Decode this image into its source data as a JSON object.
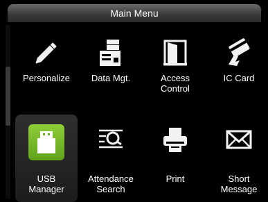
{
  "header": {
    "title": "Main Menu"
  },
  "menu": {
    "items": [
      {
        "label": "Personalize",
        "icon": "pencil-icon"
      },
      {
        "label": "Data Mgt.",
        "icon": "data-management-icon"
      },
      {
        "label": "Access\nControl",
        "icon": "door-icon"
      },
      {
        "label": "IC Card",
        "icon": "card-icon"
      },
      {
        "label": "USB\nManager",
        "icon": "usb-icon",
        "selected": true
      },
      {
        "label": "Attendance\nSearch",
        "icon": "magnifier-icon"
      },
      {
        "label": "Print",
        "icon": "printer-icon"
      },
      {
        "label": "Short\nMessage",
        "icon": "envelope-icon"
      }
    ]
  },
  "colors": {
    "accent": "#7cbd2c",
    "background": "#000000"
  }
}
